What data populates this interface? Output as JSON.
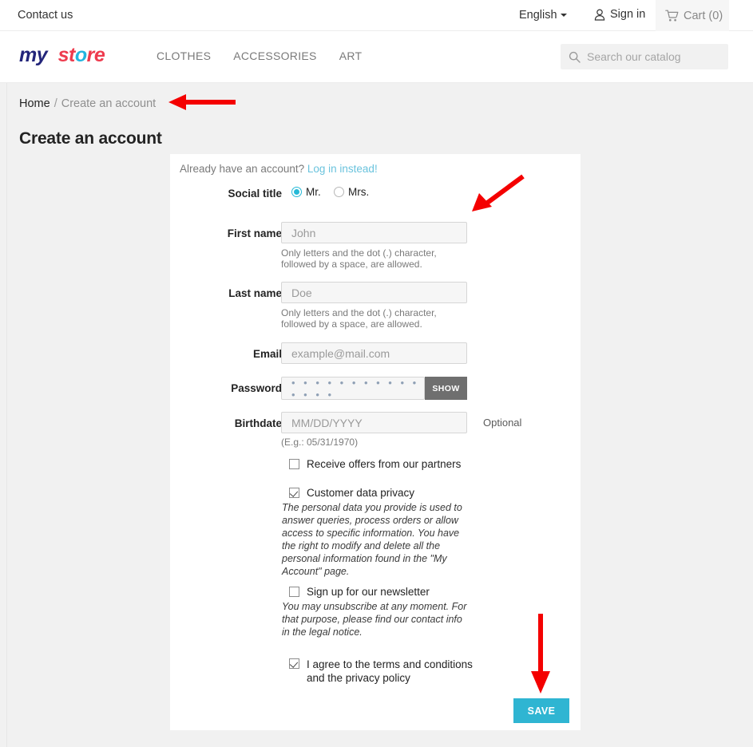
{
  "topbar": {
    "contact_us": "Contact us",
    "language": "English",
    "sign_in": "Sign in",
    "cart": "Cart (0)"
  },
  "header": {
    "logo": {
      "part1": "my",
      "part2": "store",
      "full": "my store"
    },
    "nav": [
      {
        "label": "CLOTHES"
      },
      {
        "label": "ACCESSORIES"
      },
      {
        "label": "ART"
      }
    ],
    "search": {
      "placeholder": "Search our catalog",
      "value": ""
    }
  },
  "breadcrumb": {
    "home": "Home",
    "separator": "/",
    "current": "Create an account"
  },
  "page": {
    "title": "Create an account"
  },
  "form": {
    "already_prefix": "Already have an account?",
    "login_link": "Log in instead!",
    "social_title": {
      "label": "Social title",
      "options": [
        {
          "label": "Mr.",
          "selected": true
        },
        {
          "label": "Mrs.",
          "selected": false
        }
      ]
    },
    "first_name": {
      "label": "First name",
      "placeholder": "John",
      "value": "",
      "hint": "Only letters and the dot (.) character, followed by a space, are allowed."
    },
    "last_name": {
      "label": "Last name",
      "placeholder": "Doe",
      "value": "",
      "hint": "Only letters and the dot (.) character, followed by a space, are allowed."
    },
    "email": {
      "label": "Email",
      "placeholder": "example@mail.com",
      "value": ""
    },
    "password": {
      "label": "Password",
      "masked_value": "• • • • • • • • • • • • • • •",
      "show_button": "SHOW"
    },
    "birthdate": {
      "label": "Birthdate",
      "placeholder": "MM/DD/YYYY",
      "value": "",
      "hint": "(E.g.: 05/31/1970)",
      "optional": "Optional"
    },
    "checkboxes": [
      {
        "label": "Receive offers from our partners",
        "checked": false,
        "note": ""
      },
      {
        "label": "Customer data privacy",
        "checked": true,
        "note": "The personal data you provide is used to answer queries, process orders or allow access to specific information. You have the right to modify and delete all the personal information found in the \"My Account\" page."
      },
      {
        "label": "Sign up for our newsletter",
        "checked": false,
        "note": "You may unsubscribe at any moment. For that purpose, please find our contact info in the legal notice."
      },
      {
        "label": "I agree to the terms and conditions and the privacy policy",
        "checked": true,
        "note": ""
      }
    ],
    "save_button": "SAVE"
  },
  "colors": {
    "accent": "#2fb5d2",
    "radio_selected": "#25b9d7",
    "link": "#6ac3dd",
    "annotation_arrow": "#f40000",
    "page_bg": "#f1f1f1",
    "card_bg": "#ffffff",
    "show_button_bg": "#6f6f6f"
  },
  "annotations": [
    {
      "name": "arrow-to-breadcrumb",
      "direction": "left"
    },
    {
      "name": "arrow-to-social-title",
      "direction": "down-left"
    },
    {
      "name": "arrow-to-save-button",
      "direction": "down"
    }
  ]
}
